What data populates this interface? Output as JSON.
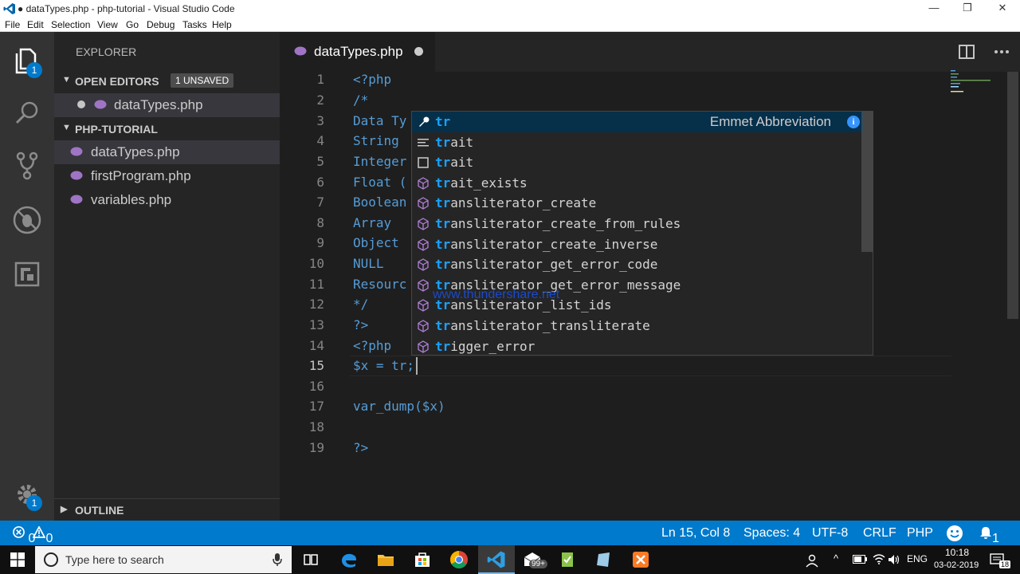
{
  "window": {
    "title": "● dataTypes.php - php-tutorial - Visual Studio Code",
    "minimize": "—",
    "maximize": "❐",
    "close": "✕"
  },
  "menu": [
    "File",
    "Edit",
    "Selection",
    "View",
    "Go",
    "Debug",
    "Tasks",
    "Help"
  ],
  "activity": {
    "explorer_badge": "1",
    "settings_badge": "1"
  },
  "sidebar": {
    "title": "EXPLORER",
    "open_editors": {
      "label": "OPEN EDITORS",
      "badge": "1 UNSAVED",
      "files": [
        "dataTypes.php"
      ]
    },
    "project": {
      "label": "PHP-TUTORIAL",
      "files": [
        "dataTypes.php",
        "firstProgram.php",
        "variables.php"
      ]
    },
    "outline": "OUTLINE"
  },
  "editor": {
    "tab_label": "dataTypes.php",
    "lines": [
      {
        "n": "1",
        "text": "<?php"
      },
      {
        "n": "2",
        "text": "/*"
      },
      {
        "n": "3",
        "text": "Data Ty"
      },
      {
        "n": "4",
        "text": "String"
      },
      {
        "n": "5",
        "text": "Integer"
      },
      {
        "n": "6",
        "text": "Float ("
      },
      {
        "n": "7",
        "text": "Boolean"
      },
      {
        "n": "8",
        "text": "Array"
      },
      {
        "n": "9",
        "text": "Object"
      },
      {
        "n": "10",
        "text": "NULL"
      },
      {
        "n": "11",
        "text": "Resourc"
      },
      {
        "n": "12",
        "text": "*/"
      },
      {
        "n": "13",
        "text": "?>"
      },
      {
        "n": "14",
        "text": "<?php"
      },
      {
        "n": "15",
        "text": "$x = tr;"
      },
      {
        "n": "16",
        "text": ""
      },
      {
        "n": "17",
        "text": "var_dump($x)"
      },
      {
        "n": "18",
        "text": ""
      },
      {
        "n": "19",
        "text": "?>"
      }
    ]
  },
  "suggest": {
    "items": [
      {
        "match": "tr",
        "rest": "",
        "detail": "Emmet Abbreviation",
        "icon": "wrench-icon"
      },
      {
        "match": "tr",
        "rest": "ait",
        "icon": "snippet-icon"
      },
      {
        "match": "tr",
        "rest": "ait",
        "icon": "keyword-icon"
      },
      {
        "match": "tr",
        "rest": "ait_exists",
        "icon": "method-icon"
      },
      {
        "match": "tr",
        "rest": "ansliterator_create",
        "icon": "method-icon"
      },
      {
        "match": "tr",
        "rest": "ansliterator_create_from_rules",
        "icon": "method-icon"
      },
      {
        "match": "tr",
        "rest": "ansliterator_create_inverse",
        "icon": "method-icon"
      },
      {
        "match": "tr",
        "rest": "ansliterator_get_error_code",
        "icon": "method-icon"
      },
      {
        "match": "tr",
        "rest": "ansliterator_get_error_message",
        "icon": "method-icon"
      },
      {
        "match": "tr",
        "rest": "ansliterator_list_ids",
        "icon": "method-icon"
      },
      {
        "match": "tr",
        "rest": "ansliterator_transliterate",
        "icon": "method-icon"
      },
      {
        "match": "tr",
        "rest": "igger_error",
        "icon": "method-icon"
      }
    ],
    "watermark": "www.thundershare.net"
  },
  "status": {
    "errors": "0",
    "warnings": "0",
    "position": "Ln 15, Col 8",
    "spaces": "Spaces: 4",
    "encoding": "UTF-8",
    "eol": "CRLF",
    "language": "PHP",
    "notifications": "1"
  },
  "taskbar": {
    "search_placeholder": "Type here to search",
    "mail_badge": "99+",
    "lang": "ENG",
    "time": "10:18",
    "date": "03-02-2019",
    "notif_count": "18"
  },
  "colors": {
    "accent": "#007acc",
    "keyword": "#569cd6",
    "match_highlight": "#18a3ff"
  }
}
